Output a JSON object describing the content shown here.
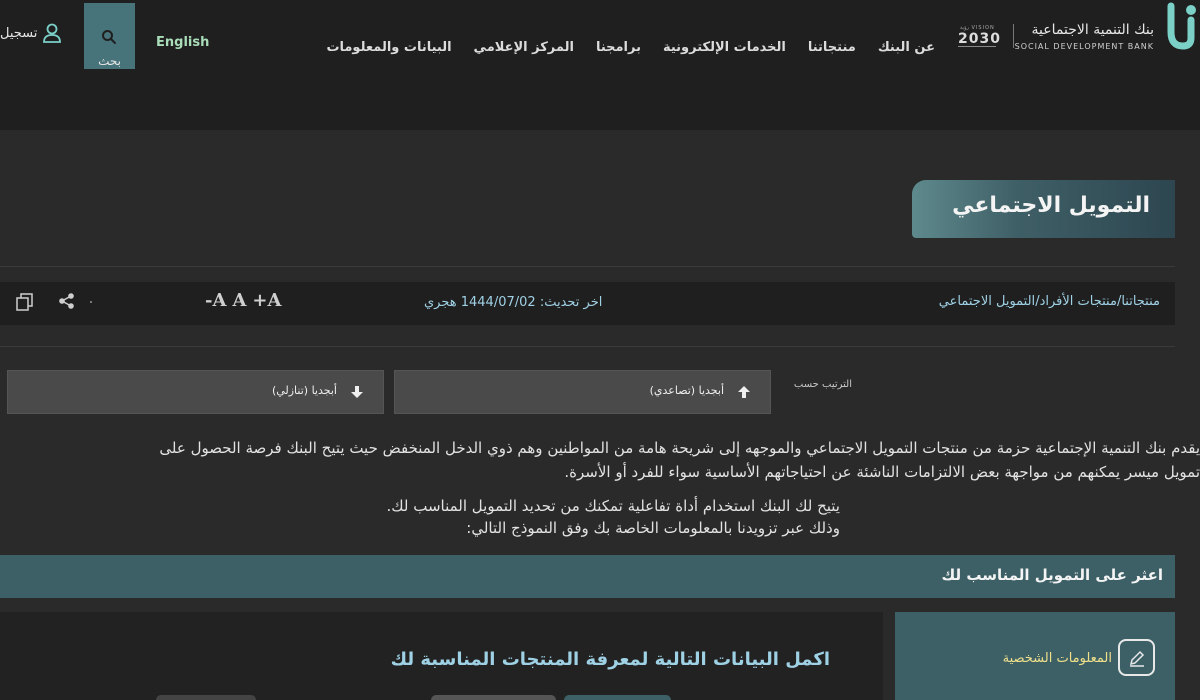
{
  "header": {
    "logo_ar": "بنك التنمية الاجتماعية",
    "logo_en": "SOCIAL DEVELOPMENT BANK",
    "vision_small": "VISION رؤية",
    "vision_year": "2030",
    "nav": [
      "عن البنك",
      "منتجاتنا",
      "الخدمات الإلكترونية",
      "برامجنا",
      "المركز الإعلامي",
      "البيانات والمعلومات"
    ],
    "language": "English",
    "search_label": "بحث",
    "login_label": "تسجيل"
  },
  "page": {
    "title": "التمويل الاجتماعي"
  },
  "toolbar": {
    "breadcrumb": [
      "منتجاتنا",
      "منتجات الأفراد",
      "التمويل الاجتماعي"
    ],
    "breadcrumb_sep": "/",
    "updated_label": "اخر تحديث:",
    "updated_value": "1444/07/02 هجري",
    "font_increase": "+A",
    "font_reset": "A",
    "font_decrease": "-A"
  },
  "sort": {
    "label": "الترتيب حسب",
    "asc": "أبجديا (تصاعدي)",
    "desc": "أبجديا (تنازلي)"
  },
  "intro": {
    "line1": "يقدم بنك التنمية الإجتماعية حزمة من منتجات التمويل الاجتماعي والموجهه إلى شريحة هامة من المواطنين وهم ذوي الدخل المنخفض حيث يتيح البنك فرصة الحصول على",
    "line2": "تمويل ميسر يمكنهم من مواجهة بعض الالتزامات الناشئة عن احتياجاتهم الأساسية سواء للفرد أو الأسرة.",
    "line3": "يتيح لك البنك استخدام أداة تفاعلية تمكنك من تحديد التمويل المناسب لك.",
    "line4": "وذلك عبر تزويدنا بالمعلومات الخاصة بك وفق النموذج التالي:"
  },
  "finder": {
    "title": "اعثر على التمويل المناسب لك",
    "form_title": "اكمل البيانات التالية لمعرفة المنتجات المناسبة لك",
    "step_label": "المعلومات الشخصية"
  },
  "colors": {
    "background": "#2a2a2a",
    "header": "#1f1f1f",
    "accent_teal": "#3d6067",
    "link_blue": "#9fd1e5",
    "highlight_yellow": "#f0e08a"
  }
}
